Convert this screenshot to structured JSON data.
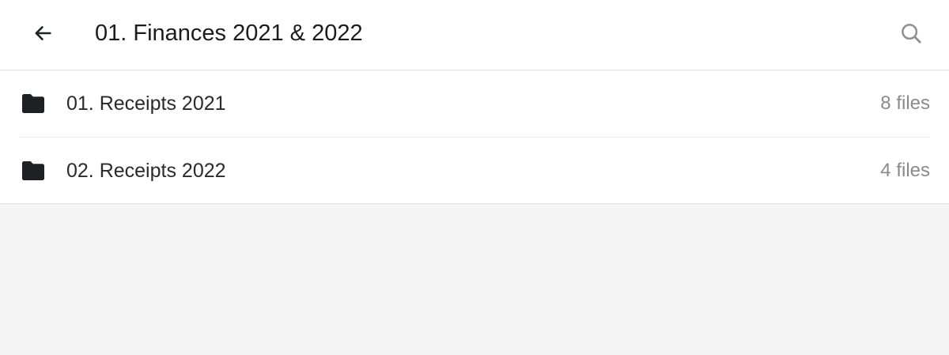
{
  "header": {
    "title": "01. Finances 2021 & 2022",
    "back_icon": "arrow-left-icon",
    "search_icon": "search-icon"
  },
  "folders": [
    {
      "name": "01. Receipts 2021",
      "count": "8 files",
      "icon": "folder-icon"
    },
    {
      "name": "02. Receipts 2022",
      "count": "4 files",
      "icon": "folder-icon"
    }
  ],
  "colors": {
    "background": "#f4f4f4",
    "surface": "#ffffff",
    "text_primary": "#1c1c1c",
    "text_secondary": "#8a8a8a",
    "icon_dark": "#1e2024",
    "icon_muted": "#8f8f8f"
  }
}
